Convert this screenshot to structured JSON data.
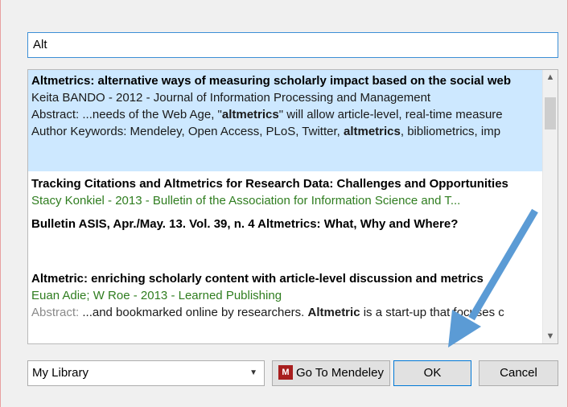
{
  "search": {
    "value": "Alt"
  },
  "results": [
    {
      "title": "Altmetrics: alternative ways of measuring scholarly impact based on the social web",
      "meta": "Keita BANDO - 2012 - Journal of Information Processing and Management",
      "abstract_prefix": "Abstract: ...needs of the Web Age, \"",
      "abstract_bold": "altmetrics",
      "abstract_suffix": "\" will allow article-level, real-time measure",
      "keywords_prefix": "Author Keywords: Mendeley, Open Access, PLoS, Twitter, ",
      "keywords_bold": "altmetrics",
      "keywords_suffix": ", bibliometrics, imp"
    },
    {
      "title": "Tracking Citations and Altmetrics for Research Data: Challenges and Opportunities",
      "meta": "Stacy Konkiel - 2013 - Bulletin of the Association for Information Science and T..."
    },
    {
      "title": "Bulletin ASIS, Apr./May. 13. Vol. 39, n. 4 Altmetrics: What, Why and Where?"
    },
    {
      "title": "Altmetric: enriching scholarly content with article-level discussion and metrics",
      "meta": "Euan Adie; W Roe - 2013 - Learned Publishing",
      "abstract_label": "Abstract: ",
      "abstract_prefix": "...and bookmarked online by researchers. ",
      "abstract_bold": "Altmetric",
      "abstract_suffix": " is a start-up that focuses c"
    }
  ],
  "scroll": {
    "up_icon": "▲",
    "down_icon": "▼"
  },
  "library": {
    "selected": "My Library",
    "arrow": "▼"
  },
  "buttons": {
    "mendeley_logo": "M",
    "mendeley": "Go To Mendeley",
    "ok": "OK",
    "cancel": "Cancel"
  },
  "annotation": {
    "arrow_color": "#5b9bd5"
  }
}
